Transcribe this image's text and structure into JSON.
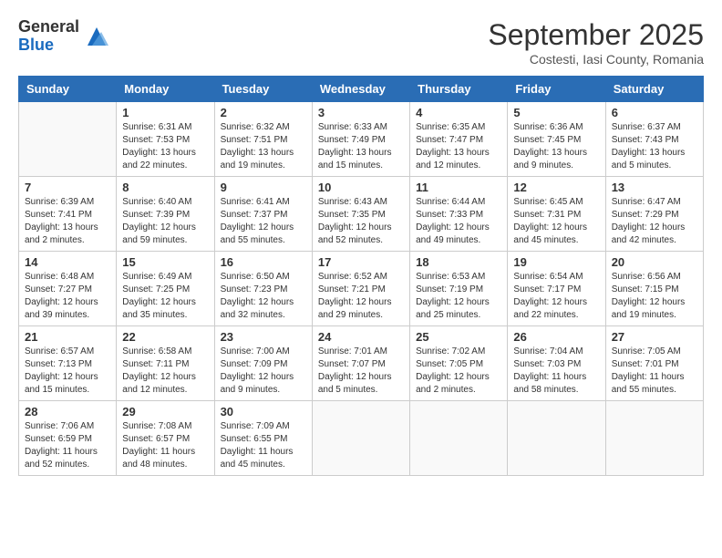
{
  "header": {
    "logo": {
      "general": "General",
      "blue": "Blue"
    },
    "title": "September 2025",
    "location": "Costesti, Iasi County, Romania"
  },
  "calendar": {
    "days_of_week": [
      "Sunday",
      "Monday",
      "Tuesday",
      "Wednesday",
      "Thursday",
      "Friday",
      "Saturday"
    ],
    "weeks": [
      [
        {
          "day": "",
          "info": ""
        },
        {
          "day": "1",
          "info": "Sunrise: 6:31 AM\nSunset: 7:53 PM\nDaylight: 13 hours\nand 22 minutes."
        },
        {
          "day": "2",
          "info": "Sunrise: 6:32 AM\nSunset: 7:51 PM\nDaylight: 13 hours\nand 19 minutes."
        },
        {
          "day": "3",
          "info": "Sunrise: 6:33 AM\nSunset: 7:49 PM\nDaylight: 13 hours\nand 15 minutes."
        },
        {
          "day": "4",
          "info": "Sunrise: 6:35 AM\nSunset: 7:47 PM\nDaylight: 13 hours\nand 12 minutes."
        },
        {
          "day": "5",
          "info": "Sunrise: 6:36 AM\nSunset: 7:45 PM\nDaylight: 13 hours\nand 9 minutes."
        },
        {
          "day": "6",
          "info": "Sunrise: 6:37 AM\nSunset: 7:43 PM\nDaylight: 13 hours\nand 5 minutes."
        }
      ],
      [
        {
          "day": "7",
          "info": "Sunrise: 6:39 AM\nSunset: 7:41 PM\nDaylight: 13 hours\nand 2 minutes."
        },
        {
          "day": "8",
          "info": "Sunrise: 6:40 AM\nSunset: 7:39 PM\nDaylight: 12 hours\nand 59 minutes."
        },
        {
          "day": "9",
          "info": "Sunrise: 6:41 AM\nSunset: 7:37 PM\nDaylight: 12 hours\nand 55 minutes."
        },
        {
          "day": "10",
          "info": "Sunrise: 6:43 AM\nSunset: 7:35 PM\nDaylight: 12 hours\nand 52 minutes."
        },
        {
          "day": "11",
          "info": "Sunrise: 6:44 AM\nSunset: 7:33 PM\nDaylight: 12 hours\nand 49 minutes."
        },
        {
          "day": "12",
          "info": "Sunrise: 6:45 AM\nSunset: 7:31 PM\nDaylight: 12 hours\nand 45 minutes."
        },
        {
          "day": "13",
          "info": "Sunrise: 6:47 AM\nSunset: 7:29 PM\nDaylight: 12 hours\nand 42 minutes."
        }
      ],
      [
        {
          "day": "14",
          "info": "Sunrise: 6:48 AM\nSunset: 7:27 PM\nDaylight: 12 hours\nand 39 minutes."
        },
        {
          "day": "15",
          "info": "Sunrise: 6:49 AM\nSunset: 7:25 PM\nDaylight: 12 hours\nand 35 minutes."
        },
        {
          "day": "16",
          "info": "Sunrise: 6:50 AM\nSunset: 7:23 PM\nDaylight: 12 hours\nand 32 minutes."
        },
        {
          "day": "17",
          "info": "Sunrise: 6:52 AM\nSunset: 7:21 PM\nDaylight: 12 hours\nand 29 minutes."
        },
        {
          "day": "18",
          "info": "Sunrise: 6:53 AM\nSunset: 7:19 PM\nDaylight: 12 hours\nand 25 minutes."
        },
        {
          "day": "19",
          "info": "Sunrise: 6:54 AM\nSunset: 7:17 PM\nDaylight: 12 hours\nand 22 minutes."
        },
        {
          "day": "20",
          "info": "Sunrise: 6:56 AM\nSunset: 7:15 PM\nDaylight: 12 hours\nand 19 minutes."
        }
      ],
      [
        {
          "day": "21",
          "info": "Sunrise: 6:57 AM\nSunset: 7:13 PM\nDaylight: 12 hours\nand 15 minutes."
        },
        {
          "day": "22",
          "info": "Sunrise: 6:58 AM\nSunset: 7:11 PM\nDaylight: 12 hours\nand 12 minutes."
        },
        {
          "day": "23",
          "info": "Sunrise: 7:00 AM\nSunset: 7:09 PM\nDaylight: 12 hours\nand 9 minutes."
        },
        {
          "day": "24",
          "info": "Sunrise: 7:01 AM\nSunset: 7:07 PM\nDaylight: 12 hours\nand 5 minutes."
        },
        {
          "day": "25",
          "info": "Sunrise: 7:02 AM\nSunset: 7:05 PM\nDaylight: 12 hours\nand 2 minutes."
        },
        {
          "day": "26",
          "info": "Sunrise: 7:04 AM\nSunset: 7:03 PM\nDaylight: 11 hours\nand 58 minutes."
        },
        {
          "day": "27",
          "info": "Sunrise: 7:05 AM\nSunset: 7:01 PM\nDaylight: 11 hours\nand 55 minutes."
        }
      ],
      [
        {
          "day": "28",
          "info": "Sunrise: 7:06 AM\nSunset: 6:59 PM\nDaylight: 11 hours\nand 52 minutes."
        },
        {
          "day": "29",
          "info": "Sunrise: 7:08 AM\nSunset: 6:57 PM\nDaylight: 11 hours\nand 48 minutes."
        },
        {
          "day": "30",
          "info": "Sunrise: 7:09 AM\nSunset: 6:55 PM\nDaylight: 11 hours\nand 45 minutes."
        },
        {
          "day": "",
          "info": ""
        },
        {
          "day": "",
          "info": ""
        },
        {
          "day": "",
          "info": ""
        },
        {
          "day": "",
          "info": ""
        }
      ]
    ]
  }
}
